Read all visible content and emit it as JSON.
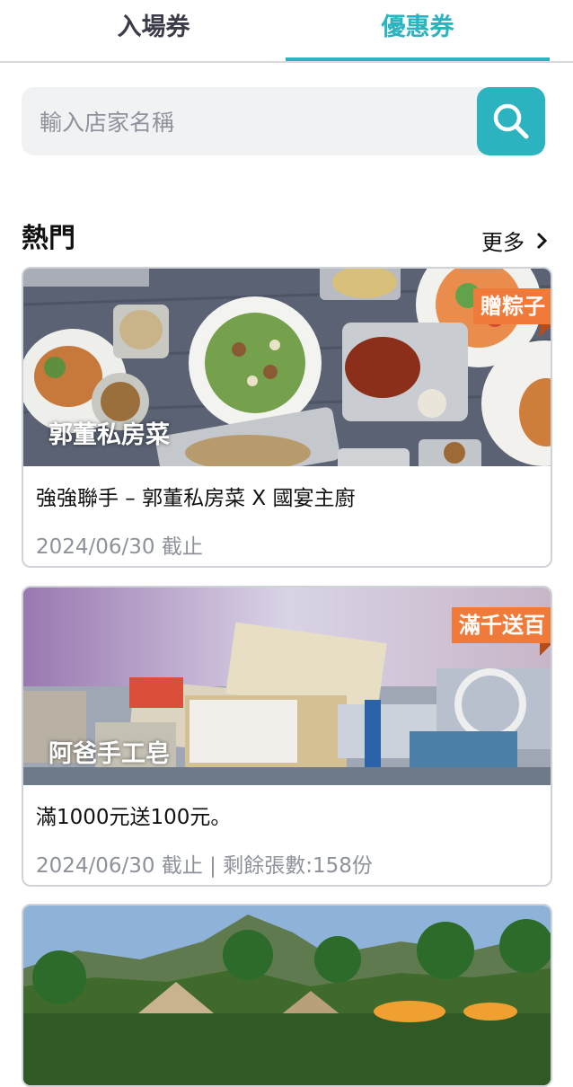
{
  "tabs": [
    {
      "label": "入場券",
      "active": false
    },
    {
      "label": "優惠券",
      "active": true
    }
  ],
  "search": {
    "placeholder": "輸入店家名稱",
    "icon": "search-icon"
  },
  "section": {
    "title": "熱門",
    "more_label": "更多"
  },
  "cards": [
    {
      "store": "郭董私房菜",
      "badge": "贈粽子",
      "title": "強強聯手 – 郭董私房菜 X 國宴主廚",
      "meta": "2024/06/30 截止"
    },
    {
      "store": "阿爸手工皂",
      "badge": "滿千送百",
      "title": "滿1000元送100元。",
      "meta": "2024/06/30 截止 | 剩餘張數:158份"
    },
    {
      "store": "",
      "badge": "",
      "title": "",
      "meta": ""
    }
  ],
  "colors": {
    "accent": "#2bb3c0",
    "badge": "#f07a3a"
  }
}
